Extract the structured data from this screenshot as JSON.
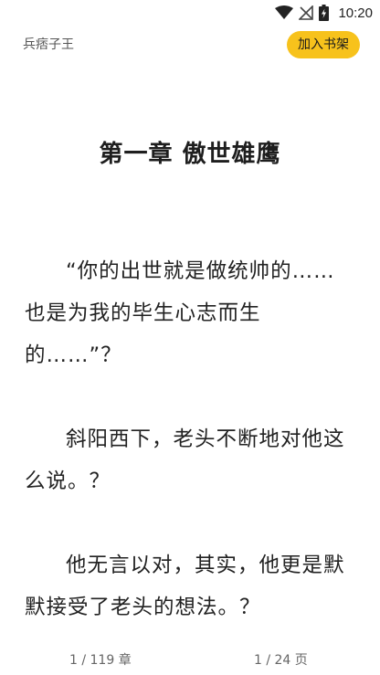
{
  "status_bar": {
    "time": "10:20",
    "icons": [
      "wifi-icon",
      "no-signal-icon",
      "battery-icon"
    ]
  },
  "header": {
    "book_title": "兵痞子王",
    "add_to_shelf_label": "加入书架",
    "accent_color": "#f7c21c"
  },
  "chapter": {
    "title": "第一章 傲世雄鹰",
    "paragraphs": [
      "“你的出世就是做统帅的……也是为我的毕生心志而生的……”？",
      "斜阳西下，老头不断地对他这么说。？",
      "他无言以对，其实，他更是默默接受了老头的想法。？"
    ]
  },
  "footer": {
    "chapter_progress": "1 / 119 章",
    "page_progress": "1 / 24 页"
  }
}
